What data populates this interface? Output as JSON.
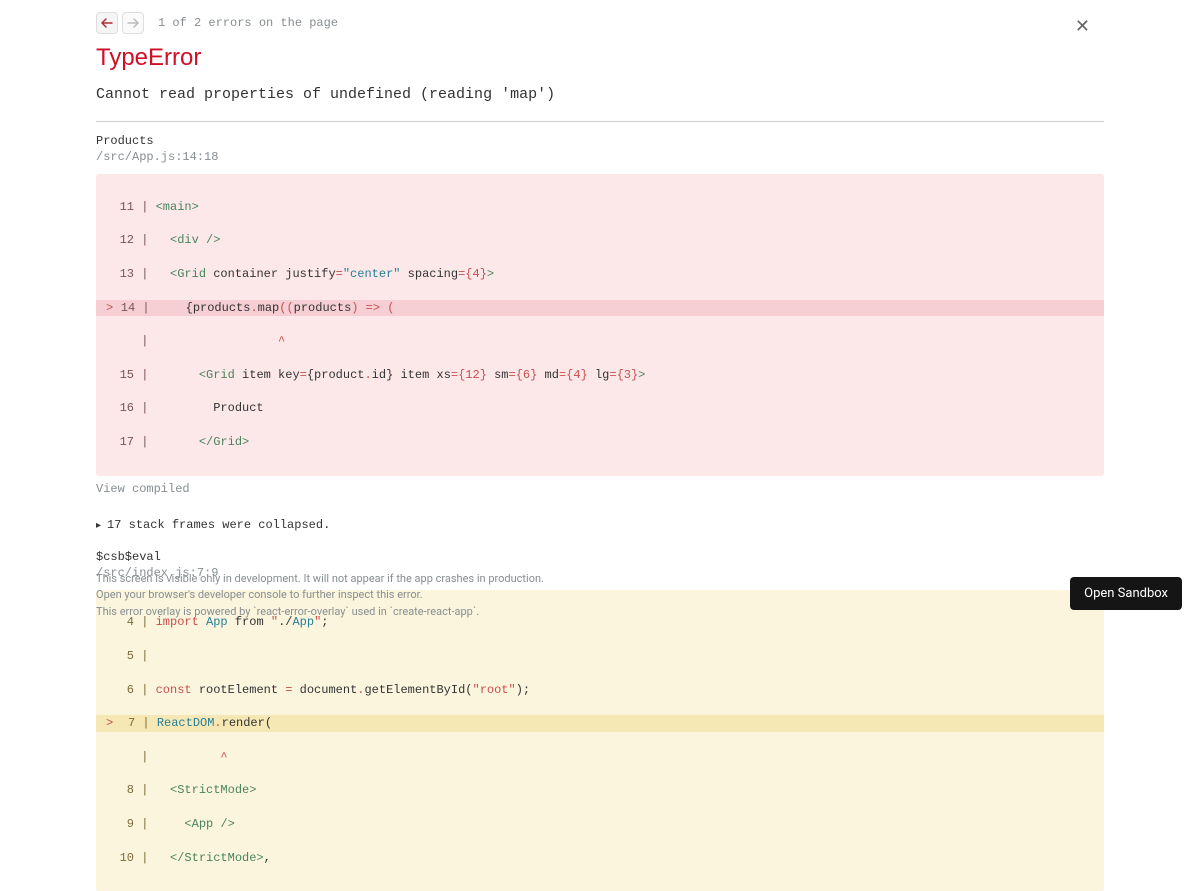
{
  "nav": {
    "counter": "1 of 2 errors on the page"
  },
  "error": {
    "type": "TypeError",
    "message": "Cannot read properties of undefined (reading 'map')"
  },
  "frame1": {
    "name": "Products",
    "location": "/src/App.js:14:18"
  },
  "view_compiled": "View compiled",
  "collapsed_text": "17 stack frames were collapsed.",
  "frame2": {
    "name": "$csb$eval",
    "location": "/src/index.js:7:9"
  },
  "footer": {
    "line1": "This screen is visible only in development. It will not appear if the app crashes in production.",
    "line2": "Open your browser's developer console to further inspect this error.",
    "line3": "This error overlay is powered by `react-error-overlay` used in `create-react-app`."
  },
  "sandbox_btn": "Open Sandbox"
}
